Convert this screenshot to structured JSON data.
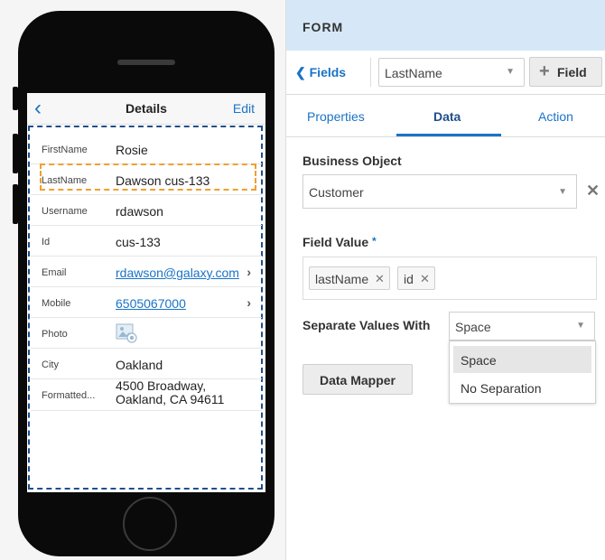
{
  "phone": {
    "nav": {
      "back_icon": "chevron-left-icon",
      "title": "Details",
      "edit_label": "Edit"
    },
    "rows": [
      {
        "label": "FirstName",
        "value": "Rosie"
      },
      {
        "label": "LastName",
        "value": "Dawson cus-133"
      },
      {
        "label": "Username",
        "value": "rdawson"
      },
      {
        "label": "Id",
        "value": "cus-133"
      },
      {
        "label": "Email",
        "value": "rdawson@galaxy.com"
      },
      {
        "label": "Mobile",
        "value": "6505067000"
      },
      {
        "label": "Photo",
        "value": ""
      },
      {
        "label": "City",
        "value": "Oakland"
      },
      {
        "label": "Formatted...",
        "value_line1": "4500 Broadway,",
        "value_line2": "Oakland, CA 94611"
      }
    ]
  },
  "panel": {
    "header_title": "FORM",
    "toolbar": {
      "back_label": "Fields",
      "field_select_value": "LastName",
      "add_field_label": "Field"
    },
    "tabs": [
      {
        "label": "Properties"
      },
      {
        "label": "Data"
      },
      {
        "label": "Action"
      }
    ],
    "business_object": {
      "label": "Business Object",
      "value": "Customer"
    },
    "field_value": {
      "label": "Field Value",
      "required_marker": "*",
      "chips": [
        "lastName",
        "id"
      ]
    },
    "separate_values": {
      "label": "Separate Values With",
      "selected": "Space",
      "options": [
        "Space",
        "No Separation"
      ]
    },
    "data_mapper_label": "Data Mapper"
  },
  "colors": {
    "accent": "#1a73c7",
    "header_bg": "#d6e8f7",
    "selection_outline": "#f0a030",
    "form_outline": "#1f4f8a"
  }
}
